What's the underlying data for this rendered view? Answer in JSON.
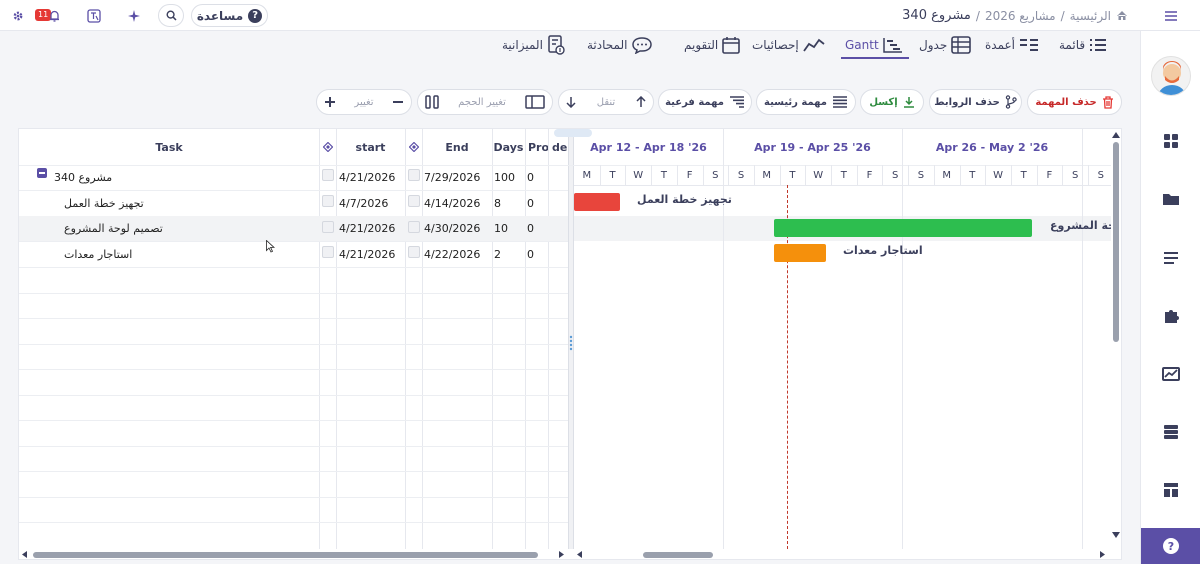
{
  "topbar": {
    "help_label": "مساعدة",
    "help_q": "?",
    "notification_count": "11",
    "breadcrumb": [
      "الرئيسية",
      "/",
      "مشاريع 2026",
      "/",
      "مشروع 340"
    ]
  },
  "tabs": [
    {
      "label": "قائمة",
      "icon": "list-icon"
    },
    {
      "label": "أعمدة",
      "icon": "columns-icon"
    },
    {
      "label": "جدول",
      "icon": "table-icon"
    },
    {
      "label": "Gantt",
      "icon": "gantt-icon",
      "active": true
    },
    {
      "label": "إحصائيات",
      "icon": "stats-icon"
    },
    {
      "label": "التقويم",
      "icon": "calendar-icon"
    },
    {
      "label": "المحادثة",
      "icon": "chat-icon"
    },
    {
      "label": "الميزانية",
      "icon": "budget-icon"
    }
  ],
  "toolbar": {
    "delete_task": "حذف المهمة",
    "delete_links": "حذف الروابط",
    "excel": "إكسل",
    "main_task": "مهمة رئيسية",
    "sub_task": "مهمة فرعية",
    "move": "تنقل",
    "resize": "تغيير الحجم",
    "change": "تغيير"
  },
  "grid": {
    "headers": {
      "task": "Task",
      "start": "start",
      "end": "End",
      "days": "Days",
      "progress": "Pro",
      "deps": "dep"
    },
    "rows": [
      {
        "task": "مشروع 340",
        "start": "4/21/2026",
        "end": "7/29/2026",
        "days": "100",
        "progress": "0"
      },
      {
        "task": "تجهيز خطة العمل",
        "start": "4/7/2026",
        "end": "4/14/2026",
        "days": "8",
        "progress": "0"
      },
      {
        "task": "تصميم لوحة المشروع",
        "start": "4/21/2026",
        "end": "4/30/2026",
        "days": "10",
        "progress": "0"
      },
      {
        "task": "استاجار معدات",
        "start": "4/21/2026",
        "end": "4/22/2026",
        "days": "2",
        "progress": "0"
      }
    ]
  },
  "gantt": {
    "weeks": [
      "Apr 12 - Apr 18 '26",
      "Apr 19 - Apr 25 '26",
      "Apr 26 - May 2 '26"
    ],
    "days": [
      "M",
      "T",
      "W",
      "T",
      "F",
      "S",
      "S",
      "M",
      "T",
      "W",
      "T",
      "F",
      "S",
      "S",
      "M",
      "T",
      "W",
      "T",
      "F",
      "S",
      "S"
    ],
    "bars": [
      {
        "label": "تجهيز خطة العمل",
        "color": "#e8453c"
      },
      {
        "label": "تصميم لوحة المشروع",
        "color": "#2dbe4f"
      },
      {
        "label": "استاجار معدات",
        "color": "#f5900c"
      }
    ],
    "today_color": "#c0392b"
  },
  "colors": {
    "accent": "#5b4fa6",
    "danger": "#e53935",
    "success": "#2e8b3e"
  }
}
